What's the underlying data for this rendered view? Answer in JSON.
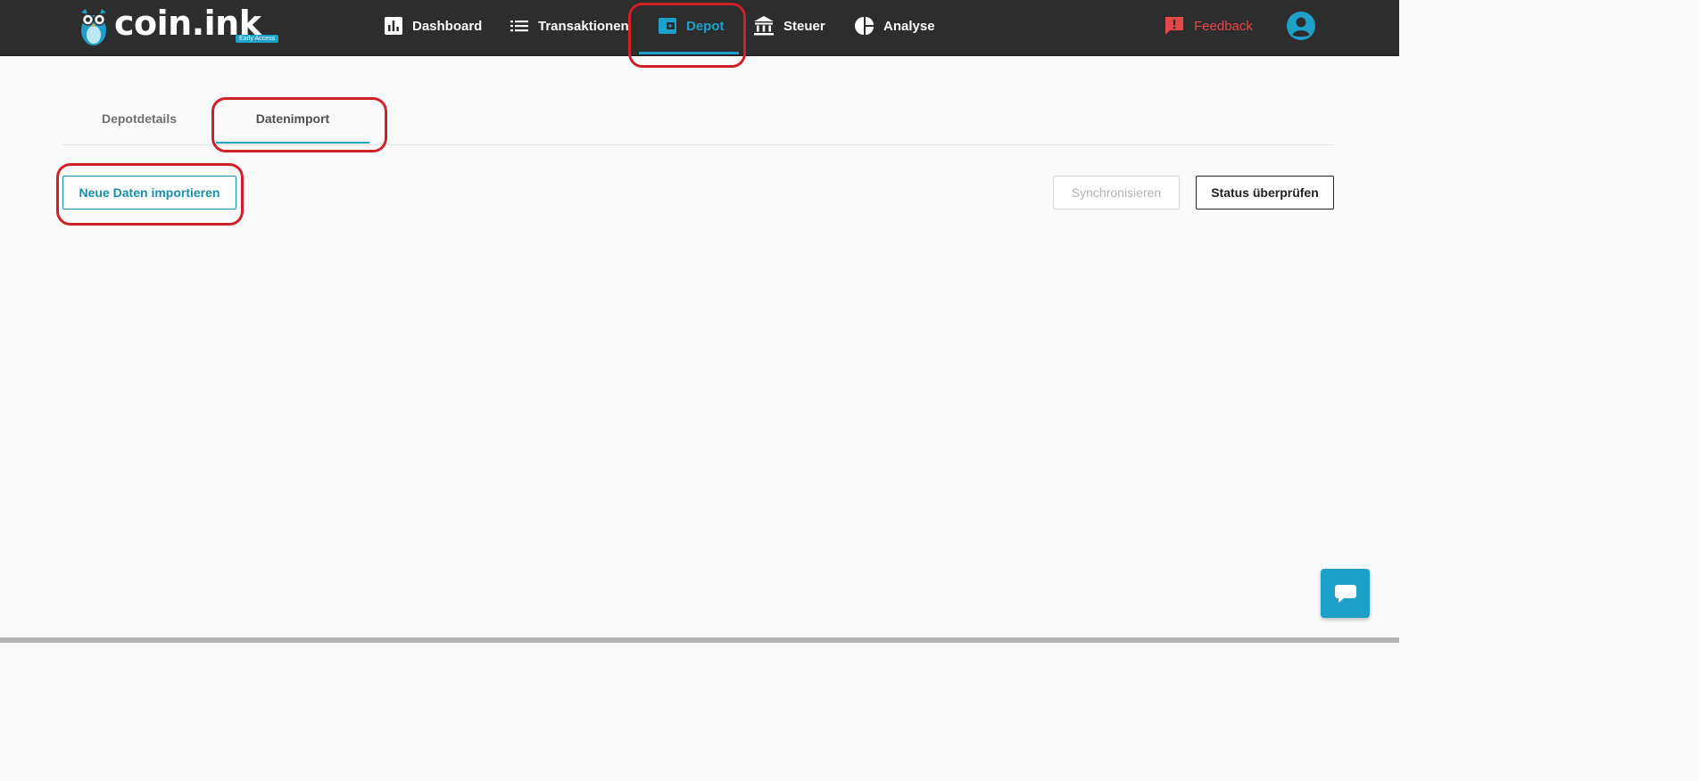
{
  "header": {
    "logo_text": "coin.ink",
    "logo_badge": "Early Access",
    "nav": [
      {
        "label": "Dashboard",
        "icon": "bar-chart-icon"
      },
      {
        "label": "Transaktionen",
        "icon": "list-icon"
      },
      {
        "label": "Depot",
        "icon": "wallet-icon",
        "active": true
      },
      {
        "label": "Steuer",
        "icon": "bank-icon"
      },
      {
        "label": "Analyse",
        "icon": "pie-chart-icon"
      }
    ],
    "feedback_label": "Feedback",
    "account_icon": "account-circle-icon"
  },
  "tabs": [
    {
      "label": "Depotdetails"
    },
    {
      "label": "Datenimport",
      "active": true
    }
  ],
  "actions": {
    "import_label": "Neue Daten importieren",
    "sync_label": "Synchronisieren",
    "sync_disabled": true,
    "status_label": "Status überprüfen"
  },
  "chat": {
    "icon": "chat-bubble-icon"
  },
  "colors": {
    "accent": "#1da1c9",
    "topbar": "#2d2d2d",
    "feedback": "#e5474b",
    "annotation": "#d0212b"
  }
}
